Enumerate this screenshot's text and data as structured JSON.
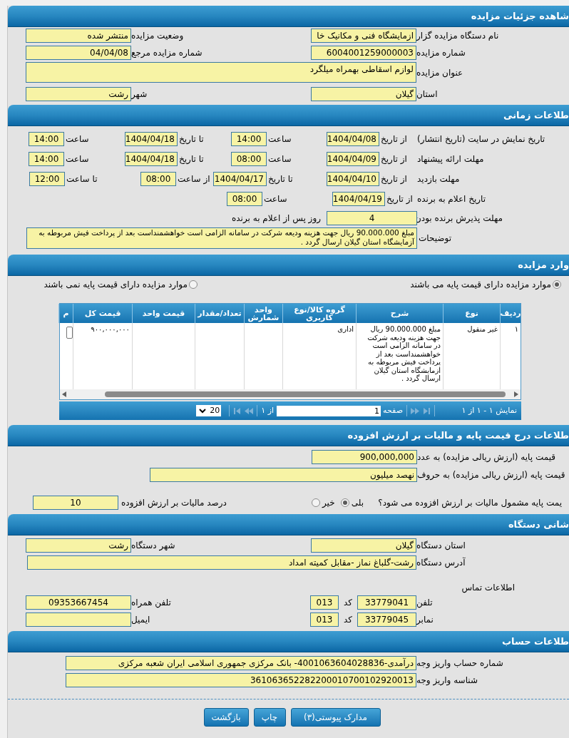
{
  "details": {
    "title": "شاهده جزئیات مزایده",
    "rows": [
      [
        {
          "label": "نام دستگاه مزایده گزار",
          "value": "ازمایشگاه فنی و مکانیک خا"
        },
        {
          "label": "وضعیت مزایده",
          "value": "منتشر شده"
        }
      ],
      [
        {
          "label": "شماره مزایده",
          "value": "6004001259000003"
        },
        {
          "label": "شماره مزایده مرجع",
          "value": "04/04/08"
        }
      ],
      [
        {
          "label": "عنوان مزایده",
          "value": "لوازم اسقاطی  بهمراه میلگرد"
        }
      ],
      [
        {
          "label": "استان",
          "value": "گیلان"
        },
        {
          "label": "شهر",
          "value": "رشت"
        }
      ]
    ]
  },
  "schedule": {
    "title": "طلاعات زمانی",
    "rows": [
      {
        "label": "تاریخ نمایش در سایت (تاریخ انتشار)",
        "parts": [
          {
            "label": "از تاریخ",
            "value": "1404/04/08"
          },
          {
            "label": "ساعت",
            "value": "14:00"
          },
          {
            "label": "تا تاریخ",
            "value": "1404/04/18"
          },
          {
            "label": "ساعت",
            "value": "14:00"
          }
        ]
      },
      {
        "label": "مهلت ارائه پیشنهاد",
        "parts": [
          {
            "label": "از تاریخ",
            "value": "1404/04/09"
          },
          {
            "label": "ساعت",
            "value": "08:00"
          },
          {
            "label": "تا تاریخ",
            "value": "1404/04/18"
          },
          {
            "label": "ساعت",
            "value": "14:00"
          }
        ]
      },
      {
        "label": "مهلت بازدید",
        "parts": [
          {
            "label": "از تاریخ",
            "value": "1404/04/10"
          },
          {
            "label": "تا تاریخ",
            "value": "1404/04/17"
          },
          {
            "label": "از ساعت",
            "value": "08:00"
          },
          {
            "label": "تا ساعت",
            "value": "12:00"
          }
        ]
      },
      {
        "label": "تاریخ اعلام به برنده",
        "parts": [
          {
            "label": "از تاریخ",
            "value": "1404/04/19"
          },
          {
            "label": "ساعت",
            "value": "08:00"
          }
        ]
      }
    ],
    "acceptance": {
      "label": "مهلت پذیرش برنده بودن",
      "value": "4",
      "suffix": "روز پس از اعلام به برنده"
    },
    "notes": {
      "label": "توضیحات",
      "value": "مبلغ 90.000.000 ریال جهت  هزینه ودیعه شرکت در سامانه الزامی است خواهشمنداست بعد از پرداخت فیش مربوطه به آزمایشگاه استان گیلان ارسال گردد ."
    }
  },
  "items": {
    "title": "وارد مزایده",
    "options": [
      {
        "label": "موارد مزایده دارای قیمت پایه می باشند",
        "selected": true
      },
      {
        "label": "موارد مزایده دارای قیمت پایه نمی باشند",
        "selected": false
      }
    ],
    "table": {
      "columns": [
        "ردیف",
        "نوع",
        "شرح",
        "گروه کالا/نوع کاربری",
        "واحد شمارش",
        "تعداد/مقدار",
        "قیمت واحد",
        "قیمت کل",
        "م"
      ],
      "rows": [
        {
          "row_number": "۱",
          "type": "غیر منقول",
          "description": "مبلغ 90.000.000 ریال جهت  هزینه ودیعه شرکت در سامانه الزامی است خواهشمنداست بعد از پرداخت فیش مربوطه به ازمایشگاه استان گیلان ارسال گردد .",
          "category": "اداری",
          "total_price": "۹۰۰,۰۰۰,۰۰۰"
        }
      ]
    },
    "pager": {
      "summary": "نمایش ۱ - ۱ از ۱",
      "page_label": "صفحه",
      "page": "1",
      "page_count": "از ۱",
      "page_size": "20"
    }
  },
  "pricing": {
    "title": "طلاعات درج قیمت پایه و مالیات بر ارزش افزوده",
    "base_price_number": {
      "label": "قیمت پایه (ارزش ریالی مزایده) به عدد",
      "value": "900,000,000"
    },
    "base_price_words": {
      "label": "قیمت پایه (ارزش ریالی مزایده) به حروف",
      "value": "نهصد میلیون"
    },
    "vat_question": {
      "label": "یمت پایه مشمول مالیات بر ارزش افزوده می شود؟",
      "options": [
        {
          "label": "بلی",
          "selected": true
        },
        {
          "label": "خیر",
          "selected": false
        }
      ]
    },
    "vat_percent": {
      "label": "درصد مالیات بر ارزش افزوده",
      "value": "10"
    }
  },
  "address": {
    "title": "شانی دستگاه",
    "province": {
      "label": "استان دستگاه",
      "value": "گیلان"
    },
    "city": {
      "label": "شهر دستگاه",
      "value": "رشت"
    },
    "street": {
      "label": "آدرس دستگاه",
      "value": "رشت-گلباغ نماز -مقابل کمیته امداد"
    },
    "contact_heading": "اطلاعات تماس",
    "phone": {
      "label": "تلفن",
      "value": "33779041",
      "code_label": "کد",
      "code": "013"
    },
    "mobile": {
      "label": "تلفن همراه",
      "value": "09353667454"
    },
    "fax": {
      "label": "نمابر",
      "value": "33779045",
      "code_label": "کد",
      "code": "013"
    },
    "email": {
      "label": "ایمیل"
    }
  },
  "account": {
    "title": "طلاعات حساب",
    "fields": [
      {
        "label": "شماره حساب واریز وجه",
        "value": "درآمدی-4001063604028836- بانک مرکزی جمهوری اسلامی ایران شعبه مرکزی"
      },
      {
        "label": "شناسه واریز وجه",
        "value": "361063652282200010700102920013"
      }
    ]
  },
  "buttons": [
    "مدارک پیوستی(۳)",
    "چاپ",
    "بازگشت"
  ]
}
